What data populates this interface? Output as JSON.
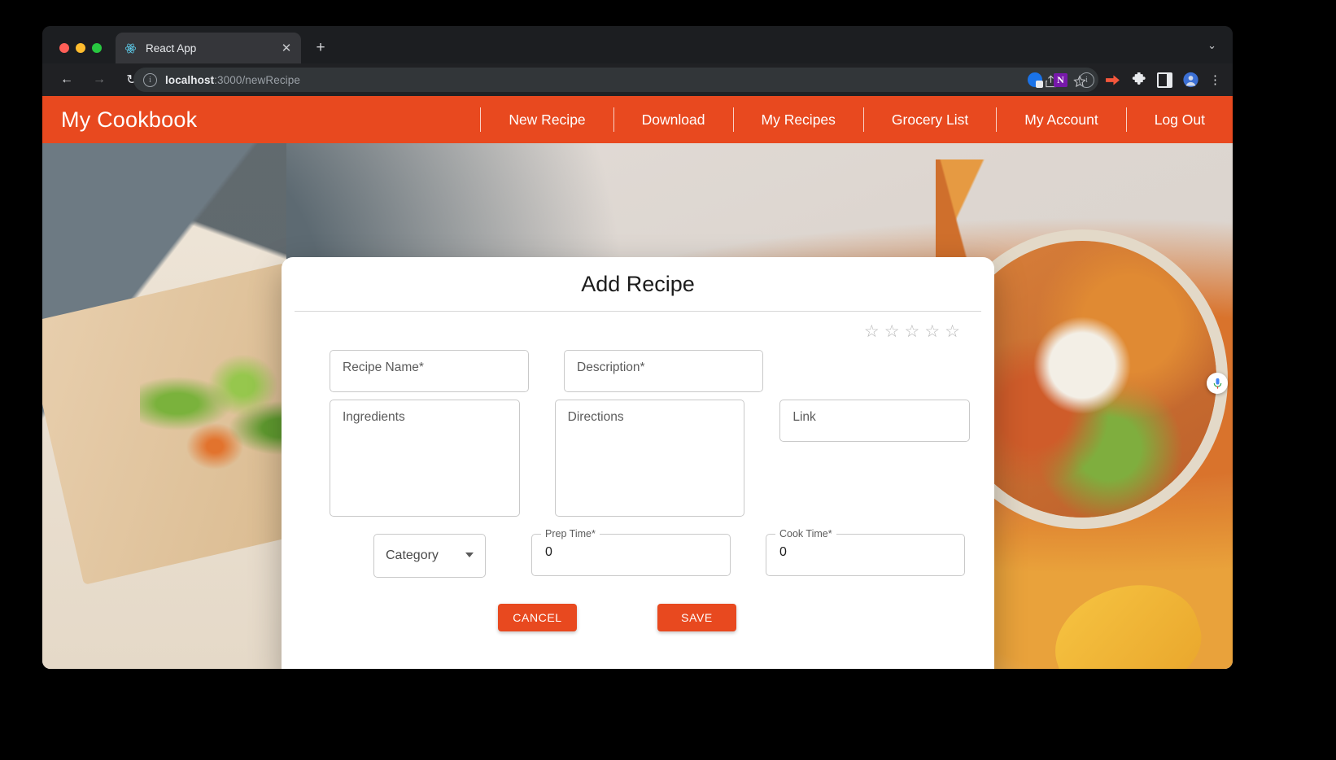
{
  "browser": {
    "tab": {
      "title": "React App",
      "favicon_icon": "react-logo-icon",
      "close_icon": "✕"
    },
    "new_tab_icon": "+",
    "tabstrip_chevron_icon": "⌄",
    "back_icon": "←",
    "forward_icon": "→",
    "reload_icon": "↻",
    "site_info_icon": "i",
    "url": {
      "host": "localhost",
      "rest": ":3000/newRecipe"
    },
    "omnibox_actions": [
      {
        "name": "share-icon",
        "glyph": "⇧"
      },
      {
        "name": "bookmark-star-icon",
        "glyph": "☆"
      }
    ],
    "toolbar_extensions": [
      {
        "name": "screen-capture-extension-icon",
        "label": ""
      },
      {
        "name": "onenote-extension-icon",
        "label": "N"
      },
      {
        "name": "info-extension-icon",
        "label": "i"
      },
      {
        "name": "pocket-extension-icon",
        "label": "➤"
      },
      {
        "name": "extensions-puzzle-icon",
        "label": "🧩"
      },
      {
        "name": "side-panel-icon",
        "label": ""
      }
    ],
    "profile_avatar_name": "profile-avatar",
    "menu_icon": "⋮"
  },
  "appbar": {
    "brand": "My Cookbook",
    "links": [
      {
        "label": "New Recipe"
      },
      {
        "label": "Download"
      },
      {
        "label": "My Recipes"
      },
      {
        "label": "Grocery List"
      },
      {
        "label": "My Account"
      },
      {
        "label": "Log Out"
      }
    ],
    "background_color": "#e8491f",
    "text_color": "#ffffff"
  },
  "dialog": {
    "title": "Add Recipe",
    "rating": {
      "value": 0,
      "max": 5,
      "empty_star_glyph": "☆",
      "star_color": "#b6b6b6"
    },
    "fields": {
      "recipe_name": {
        "placeholder": "Recipe Name",
        "required_marker": "*",
        "value": ""
      },
      "description": {
        "placeholder": "Description",
        "required_marker": "*",
        "value": ""
      },
      "ingredients": {
        "placeholder": "Ingredients",
        "required_marker": "",
        "value": ""
      },
      "directions": {
        "placeholder": "Directions",
        "required_marker": "",
        "value": ""
      },
      "link": {
        "placeholder": "Link",
        "required_marker": "",
        "value": ""
      },
      "category": {
        "label": "Category",
        "value": "",
        "caret_icon": "chevron-down-icon"
      },
      "prep_time": {
        "label": "Prep Time",
        "required_marker": "*",
        "value": "0"
      },
      "cook_time": {
        "label": "Cook Time",
        "required_marker": "*",
        "value": "0"
      }
    },
    "buttons": {
      "cancel": "CANCEL",
      "save": "SAVE",
      "color": "#e8491f"
    }
  },
  "overlay": {
    "mic_icon_name": "voice-search-mic-icon"
  }
}
